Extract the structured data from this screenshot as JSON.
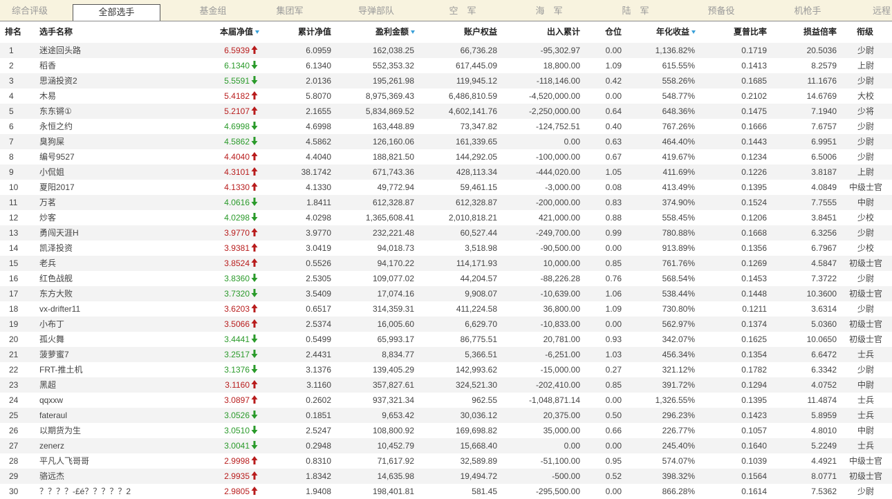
{
  "tabs": [
    {
      "label": "综合评级",
      "active": false
    },
    {
      "label": "全部选手",
      "active": true
    },
    {
      "label": "基金组",
      "active": false
    },
    {
      "label": "集团军",
      "active": false
    },
    {
      "label": "导弹部队",
      "active": false
    },
    {
      "label": "空　军",
      "active": false
    },
    {
      "label": "海　军",
      "active": false
    },
    {
      "label": "陆　军",
      "active": false
    },
    {
      "label": "预备役",
      "active": false
    },
    {
      "label": "机枪手",
      "active": false
    },
    {
      "label": "远程",
      "active": false
    }
  ],
  "headers": {
    "rank": "排名",
    "name": "选手名称",
    "nav": "本届净值",
    "cum_nav": "累计净值",
    "profit": "盈利金额",
    "equity": "账户权益",
    "inout": "出入累计",
    "position": "仓位",
    "annual": "年化收益",
    "sharpe": "夏普比率",
    "pl_ratio": "损益倍率",
    "rank_title": "衔级"
  },
  "sort_indicators": [
    "nav",
    "profit",
    "annual"
  ],
  "colors": {
    "up": "#b81c1c",
    "down": "#2a9a2a",
    "sort_icon": "#3aa0d8",
    "row_alt": "#f3f3f3",
    "tabbar_bg": "#f8f3df"
  },
  "rows": [
    {
      "rank": "1",
      "name": "迷途回头路",
      "nav": "6.5939",
      "dir": "up",
      "cum_nav": "6.0959",
      "profit": "162,038.25",
      "equity": "66,736.28",
      "inout": "-95,302.97",
      "position": "0.00",
      "annual": "1,136.82%",
      "sharpe": "0.1719",
      "pl_ratio": "20.5036",
      "title": "少尉"
    },
    {
      "rank": "2",
      "name": "稻香",
      "nav": "6.1340",
      "dir": "down",
      "cum_nav": "6.1340",
      "profit": "552,353.32",
      "equity": "617,445.09",
      "inout": "18,800.00",
      "position": "1.09",
      "annual": "615.55%",
      "sharpe": "0.1413",
      "pl_ratio": "8.2579",
      "title": "上尉"
    },
    {
      "rank": "3",
      "name": "思涵投资2",
      "nav": "5.5591",
      "dir": "down",
      "cum_nav": "2.0136",
      "profit": "195,261.98",
      "equity": "119,945.12",
      "inout": "-118,146.00",
      "position": "0.42",
      "annual": "558.26%",
      "sharpe": "0.1685",
      "pl_ratio": "11.1676",
      "title": "少尉"
    },
    {
      "rank": "4",
      "name": "木易",
      "nav": "5.4182",
      "dir": "up",
      "cum_nav": "5.8070",
      "profit": "8,975,369.43",
      "equity": "6,486,810.59",
      "inout": "-4,520,000.00",
      "position": "0.00",
      "annual": "548.77%",
      "sharpe": "0.2102",
      "pl_ratio": "14.6769",
      "title": "大校"
    },
    {
      "rank": "5",
      "name": "东东锵①",
      "nav": "5.2107",
      "dir": "up",
      "cum_nav": "2.1655",
      "profit": "5,834,869.52",
      "equity": "4,602,141.76",
      "inout": "-2,250,000.00",
      "position": "0.64",
      "annual": "648.36%",
      "sharpe": "0.1475",
      "pl_ratio": "7.1940",
      "title": "少将"
    },
    {
      "rank": "6",
      "name": "永恒之约",
      "nav": "4.6998",
      "dir": "down",
      "cum_nav": "4.6998",
      "profit": "163,448.89",
      "equity": "73,347.82",
      "inout": "-124,752.51",
      "position": "0.40",
      "annual": "767.26%",
      "sharpe": "0.1666",
      "pl_ratio": "7.6757",
      "title": "少尉"
    },
    {
      "rank": "7",
      "name": "臭狗屎",
      "nav": "4.5862",
      "dir": "down",
      "cum_nav": "4.5862",
      "profit": "126,160.06",
      "equity": "161,339.65",
      "inout": "0.00",
      "position": "0.63",
      "annual": "464.40%",
      "sharpe": "0.1443",
      "pl_ratio": "6.9951",
      "title": "少尉"
    },
    {
      "rank": "8",
      "name": "编号9527",
      "nav": "4.4040",
      "dir": "up",
      "cum_nav": "4.4040",
      "profit": "188,821.50",
      "equity": "144,292.05",
      "inout": "-100,000.00",
      "position": "0.67",
      "annual": "419.67%",
      "sharpe": "0.1234",
      "pl_ratio": "6.5006",
      "title": "少尉"
    },
    {
      "rank": "9",
      "name": "小侃姐",
      "nav": "4.3101",
      "dir": "up",
      "cum_nav": "38.1742",
      "profit": "671,743.36",
      "equity": "428,113.34",
      "inout": "-444,020.00",
      "position": "1.05",
      "annual": "411.69%",
      "sharpe": "0.1226",
      "pl_ratio": "3.8187",
      "title": "上尉"
    },
    {
      "rank": "10",
      "name": "夏阳2017",
      "nav": "4.1330",
      "dir": "up",
      "cum_nav": "4.1330",
      "profit": "49,772.94",
      "equity": "59,461.15",
      "inout": "-3,000.00",
      "position": "0.08",
      "annual": "413.49%",
      "sharpe": "0.1395",
      "pl_ratio": "4.0849",
      "title": "中级士官"
    },
    {
      "rank": "11",
      "name": "万茗",
      "nav": "4.0616",
      "dir": "down",
      "cum_nav": "1.8411",
      "profit": "612,328.87",
      "equity": "612,328.87",
      "inout": "-200,000.00",
      "position": "0.83",
      "annual": "374.90%",
      "sharpe": "0.1524",
      "pl_ratio": "7.7555",
      "title": "中尉"
    },
    {
      "rank": "12",
      "name": "炒客",
      "nav": "4.0298",
      "dir": "down",
      "cum_nav": "4.0298",
      "profit": "1,365,608.41",
      "equity": "2,010,818.21",
      "inout": "421,000.00",
      "position": "0.88",
      "annual": "558.45%",
      "sharpe": "0.1206",
      "pl_ratio": "3.8451",
      "title": "少校"
    },
    {
      "rank": "13",
      "name": "勇闯天涯H",
      "nav": "3.9770",
      "dir": "up",
      "cum_nav": "3.9770",
      "profit": "232,221.48",
      "equity": "60,527.44",
      "inout": "-249,700.00",
      "position": "0.99",
      "annual": "780.88%",
      "sharpe": "0.1668",
      "pl_ratio": "6.3256",
      "title": "少尉"
    },
    {
      "rank": "14",
      "name": "凯泽投资",
      "nav": "3.9381",
      "dir": "up",
      "cum_nav": "3.0419",
      "profit": "94,018.73",
      "equity": "3,518.98",
      "inout": "-90,500.00",
      "position": "0.00",
      "annual": "913.89%",
      "sharpe": "0.1356",
      "pl_ratio": "6.7967",
      "title": "少校"
    },
    {
      "rank": "15",
      "name": "老兵",
      "nav": "3.8524",
      "dir": "up",
      "cum_nav": "0.5526",
      "profit": "94,170.22",
      "equity": "114,171.93",
      "inout": "10,000.00",
      "position": "0.85",
      "annual": "761.76%",
      "sharpe": "0.1269",
      "pl_ratio": "4.5847",
      "title": "初级士官"
    },
    {
      "rank": "16",
      "name": "红色战舰",
      "nav": "3.8360",
      "dir": "down",
      "cum_nav": "2.5305",
      "profit": "109,077.02",
      "equity": "44,204.57",
      "inout": "-88,226.28",
      "position": "0.76",
      "annual": "568.54%",
      "sharpe": "0.1453",
      "pl_ratio": "7.3722",
      "title": "少尉"
    },
    {
      "rank": "17",
      "name": "东方大败",
      "nav": "3.7320",
      "dir": "down",
      "cum_nav": "3.5409",
      "profit": "17,074.16",
      "equity": "9,908.07",
      "inout": "-10,639.00",
      "position": "1.06",
      "annual": "538.44%",
      "sharpe": "0.1448",
      "pl_ratio": "10.3600",
      "title": "初级士官"
    },
    {
      "rank": "18",
      "name": "vx-drifter11",
      "nav": "3.6203",
      "dir": "up",
      "cum_nav": "0.6517",
      "profit": "314,359.31",
      "equity": "411,224.58",
      "inout": "36,800.00",
      "position": "1.09",
      "annual": "730.80%",
      "sharpe": "0.1211",
      "pl_ratio": "3.6314",
      "title": "少尉"
    },
    {
      "rank": "19",
      "name": "小布丁",
      "nav": "3.5066",
      "dir": "up",
      "cum_nav": "2.5374",
      "profit": "16,005.60",
      "equity": "6,629.70",
      "inout": "-10,833.00",
      "position": "0.00",
      "annual": "562.97%",
      "sharpe": "0.1374",
      "pl_ratio": "5.0360",
      "title": "初级士官"
    },
    {
      "rank": "20",
      "name": "孤火舞",
      "nav": "3.4441",
      "dir": "down",
      "cum_nav": "0.5499",
      "profit": "65,993.17",
      "equity": "86,775.51",
      "inout": "20,781.00",
      "position": "0.93",
      "annual": "342.07%",
      "sharpe": "0.1625",
      "pl_ratio": "10.0650",
      "title": "初级士官"
    },
    {
      "rank": "21",
      "name": "菠萝蜜7",
      "nav": "3.2517",
      "dir": "down",
      "cum_nav": "2.4431",
      "profit": "8,834.77",
      "equity": "5,366.51",
      "inout": "-6,251.00",
      "position": "1.03",
      "annual": "456.34%",
      "sharpe": "0.1354",
      "pl_ratio": "6.6472",
      "title": "士兵"
    },
    {
      "rank": "22",
      "name": "FRT-推土机",
      "nav": "3.1376",
      "dir": "down",
      "cum_nav": "3.1376",
      "profit": "139,405.29",
      "equity": "142,993.62",
      "inout": "-15,000.00",
      "position": "0.27",
      "annual": "321.12%",
      "sharpe": "0.1782",
      "pl_ratio": "6.3342",
      "title": "少尉"
    },
    {
      "rank": "23",
      "name": "黑超",
      "nav": "3.1160",
      "dir": "up",
      "cum_nav": "3.1160",
      "profit": "357,827.61",
      "equity": "324,521.30",
      "inout": "-202,410.00",
      "position": "0.85",
      "annual": "391.72%",
      "sharpe": "0.1294",
      "pl_ratio": "4.0752",
      "title": "中尉"
    },
    {
      "rank": "24",
      "name": "qqxxw",
      "nav": "3.0897",
      "dir": "up",
      "cum_nav": "0.2602",
      "profit": "937,321.34",
      "equity": "962.55",
      "inout": "-1,048,871.14",
      "position": "0.00",
      "annual": "1,326.55%",
      "sharpe": "0.1395",
      "pl_ratio": "11.4874",
      "title": "士兵"
    },
    {
      "rank": "25",
      "name": "fateraul",
      "nav": "3.0526",
      "dir": "down",
      "cum_nav": "0.1851",
      "profit": "9,653.42",
      "equity": "30,036.12",
      "inout": "20,375.00",
      "position": "0.50",
      "annual": "296.23%",
      "sharpe": "0.1423",
      "pl_ratio": "5.8959",
      "title": "士兵"
    },
    {
      "rank": "26",
      "name": "以期货为生",
      "nav": "3.0510",
      "dir": "down",
      "cum_nav": "2.5247",
      "profit": "108,800.92",
      "equity": "169,698.82",
      "inout": "35,000.00",
      "position": "0.66",
      "annual": "226.77%",
      "sharpe": "0.1057",
      "pl_ratio": "4.8010",
      "title": "中尉"
    },
    {
      "rank": "27",
      "name": "zenerz",
      "nav": "3.0041",
      "dir": "down",
      "cum_nav": "0.2948",
      "profit": "10,452.79",
      "equity": "15,668.40",
      "inout": "0.00",
      "position": "0.00",
      "annual": "245.40%",
      "sharpe": "0.1640",
      "pl_ratio": "5.2249",
      "title": "士兵"
    },
    {
      "rank": "28",
      "name": "平凡人飞哥哥",
      "nav": "2.9998",
      "dir": "up",
      "cum_nav": "0.8310",
      "profit": "71,617.92",
      "equity": "32,589.89",
      "inout": "-51,100.00",
      "position": "0.95",
      "annual": "574.07%",
      "sharpe": "0.1039",
      "pl_ratio": "4.4921",
      "title": "中级士官"
    },
    {
      "rank": "29",
      "name": "骆远杰",
      "nav": "2.9935",
      "dir": "up",
      "cum_nav": "1.8342",
      "profit": "14,635.98",
      "equity": "19,494.72",
      "inout": "-500.00",
      "position": "0.52",
      "annual": "398.32%",
      "sharpe": "0.1564",
      "pl_ratio": "8.0771",
      "title": "初级士官"
    },
    {
      "rank": "30",
      "name": "？？？？-£é？？？？？2",
      "nav": "2.9805",
      "dir": "up",
      "cum_nav": "1.9408",
      "profit": "198,401.81",
      "equity": "581.45",
      "inout": "-295,500.00",
      "position": "0.00",
      "annual": "866.28%",
      "sharpe": "0.1614",
      "pl_ratio": "7.5362",
      "title": "少尉"
    }
  ]
}
